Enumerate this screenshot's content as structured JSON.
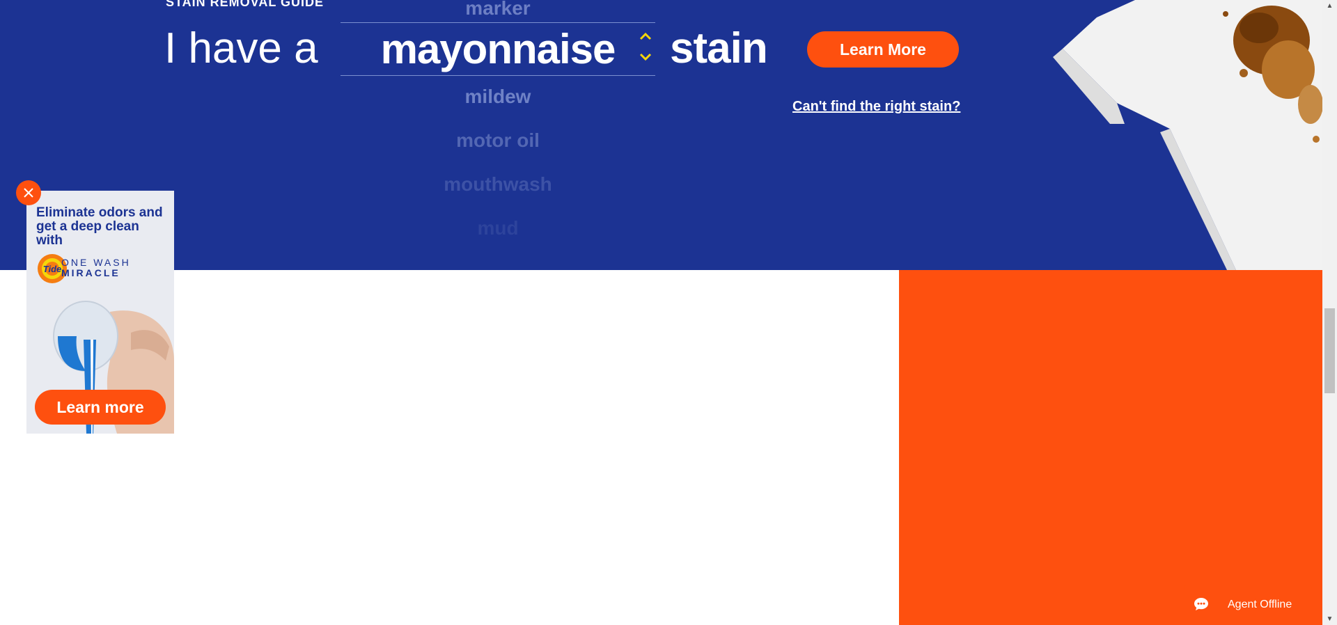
{
  "hero": {
    "eyebrow": "STAIN REMOVAL GUIDE",
    "lead": "I have a",
    "picker": {
      "above": [
        "marker"
      ],
      "selected": "mayonnaise",
      "below": [
        "mildew",
        "motor oil",
        "mouthwash",
        "mud"
      ],
      "up_icon": "chevron-up-icon",
      "down_icon": "chevron-down-icon"
    },
    "stain_word": "stain",
    "learn_more_button": "Learn More",
    "cant_find_link": "Can't find the right stain?"
  },
  "ad": {
    "headline": "Eliminate odors and get a deep clean with",
    "brand_line1": "ONE WASH",
    "brand_line2": "MIRACLE",
    "logo_text": "Tide",
    "cta": "Learn more",
    "close_icon": "close-icon"
  },
  "chat": {
    "label": "Agent Offline",
    "icon": "chat-bubble-icon"
  },
  "colors": {
    "hero_bg": "#1c3393",
    "accent": "#fe500f",
    "chevron": "#f5d60a",
    "white": "#ffffff"
  }
}
